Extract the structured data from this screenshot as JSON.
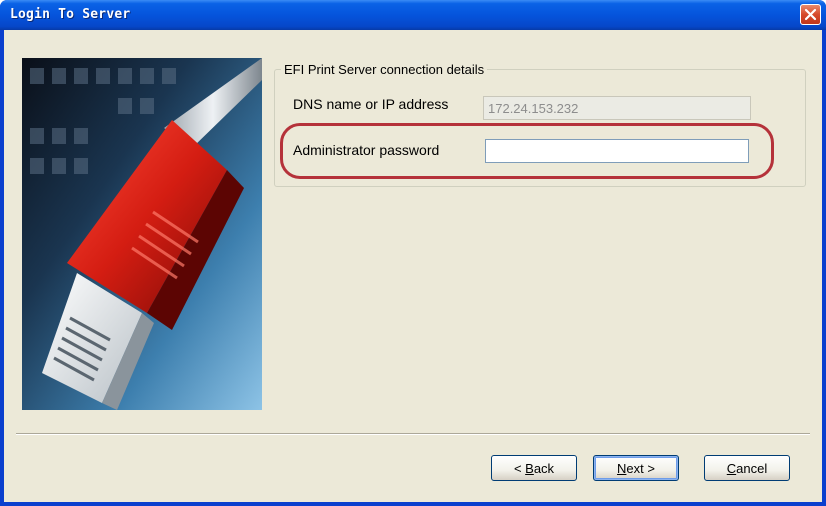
{
  "window": {
    "title": "Login To Server"
  },
  "icons": {
    "close": "close-x-icon",
    "illustration": "network-cable-plug-illustration"
  },
  "colors": {
    "title_bar": "#0554dc",
    "close_button": "#d6492a",
    "highlight_ring": "#b5323a",
    "client_bg": "#ece9d8"
  },
  "group": {
    "legend": "EFI Print Server connection details",
    "dns_label": "DNS name or IP address",
    "dns_value": "172.24.153.232",
    "password_label": "Administrator password",
    "password_value": ""
  },
  "buttons": {
    "back_mnemonic": "B",
    "back_rest": "ack",
    "back_prefix": "< ",
    "next_mnemonic": "N",
    "next_rest": "ext >",
    "cancel_mnemonic": "C",
    "cancel_rest": "ancel"
  }
}
